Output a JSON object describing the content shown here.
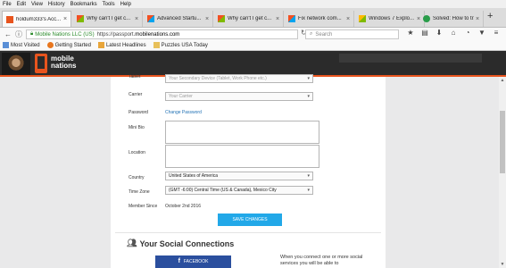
{
  "menu": [
    "File",
    "Edit",
    "View",
    "History",
    "Bookmarks",
    "Tools",
    "Help"
  ],
  "tabs": [
    {
      "title": "holdum333's Acc...",
      "active": true
    },
    {
      "title": "Why can't I get c...",
      "active": false
    },
    {
      "title": "Advanced Startu...",
      "active": false
    },
    {
      "title": "Why can't I get c...",
      "active": false
    },
    {
      "title": "Fix network com...",
      "active": false
    },
    {
      "title": "Windows 7 Explo...",
      "active": false
    },
    {
      "title": "Solved: How to tr...",
      "active": false
    }
  ],
  "newtab_label": "+",
  "window_controls": {
    "minimize": "—",
    "maximize": "☐",
    "close": "✕"
  },
  "navbar": {
    "back": "←",
    "info": "ⓘ",
    "site_identity": "Mobile Nations LLC (US)",
    "url_prefix": "https://passport.",
    "url_domain": "mobilenations.com",
    "reload": "↻",
    "search_placeholder": "Search"
  },
  "toolbar_icons": [
    "★",
    "▤",
    "⬇",
    "⌂",
    "◔",
    "▼",
    "≡"
  ],
  "bookmarks": [
    {
      "label": "Most Visited",
      "color": "#5a8fd6"
    },
    {
      "label": "Getting Started",
      "color": "#e8761e"
    },
    {
      "label": "Latest Headlines",
      "color": "#e8a53a"
    },
    {
      "label": "Puzzles USA Today",
      "color": "#e8c05a"
    }
  ],
  "header": {
    "logo_text_1": "mobile",
    "logo_text_2": "nations"
  },
  "form": {
    "tablet_label": "Tablet",
    "tablet_placeholder": "Your Secondary Device (Tablet, Work Phone etc.)",
    "carrier_label": "Carrier",
    "carrier_placeholder": "Your Carrier",
    "password_label": "Password",
    "password_link": "Change Password",
    "minibio_label": "Mini Bio",
    "location_label": "Location",
    "country_label": "Country",
    "country_value": "United States of America",
    "timezone_label": "Time Zone",
    "timezone_value": "(GMT -6:00) Central Time (US & Canada), Mexico City",
    "member_since_label": "Member Since",
    "member_since_value": "October 2nd 2016",
    "save_button": "SAVE CHANGES"
  },
  "social": {
    "title": "Your Social Connections",
    "facebook_button": "FACEBOOK",
    "facebook_icon": "f",
    "description": "When you connect one or more social services you will be able to"
  },
  "colors": {
    "accent": "#22a8e8",
    "facebook": "#2b4f9e",
    "header": "#2b2b2b",
    "brand_orange": "#e8541e"
  }
}
